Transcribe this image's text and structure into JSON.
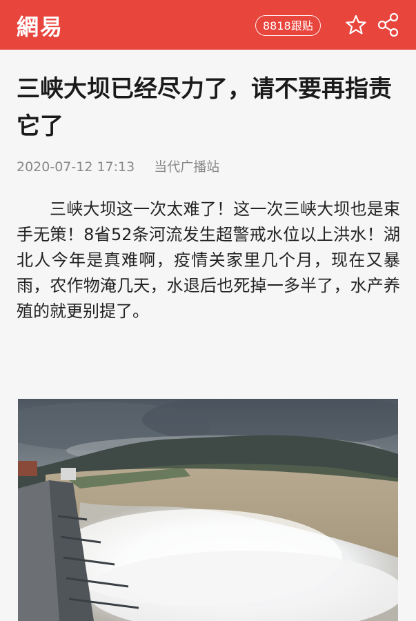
{
  "header": {
    "logo_text": "網易",
    "follow_label": "8818跟贴",
    "brand_color": "#e8453c",
    "icons": [
      "star-icon",
      "share-icon"
    ]
  },
  "article": {
    "title": "三峡大坝已经尽力了，请不要再指责它了",
    "date": "2020-07-12 17:13",
    "source": "当代广播站",
    "body": "三峡大坝这一次太难了！这一次三峡大坝也是束手无策！8省52条河流发生超警戒水位以上洪水！湖北人今年是真难啊，疫情关家里几个月，现在又暴雨，农作物淹几天，水退后也死掉一多半了，水产养殖的就更别提了。"
  },
  "image": {
    "subject": "dam-spillway-photo"
  }
}
